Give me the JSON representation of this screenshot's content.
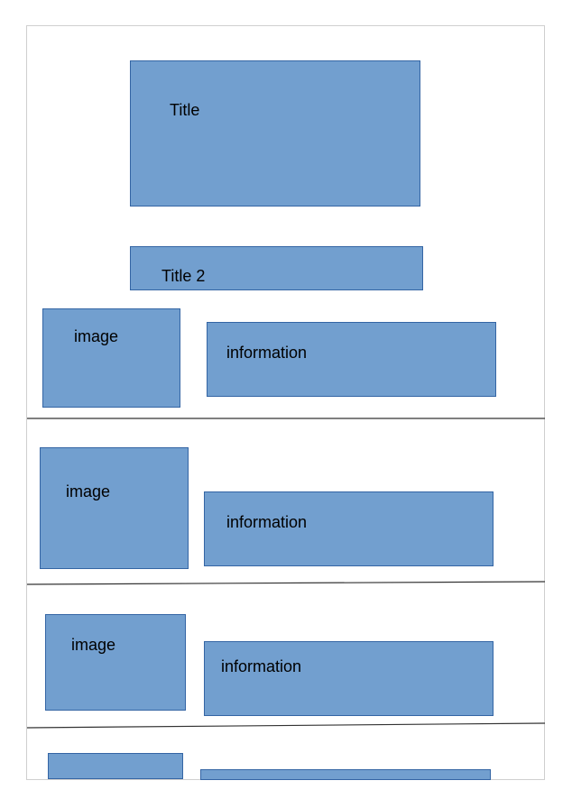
{
  "header": {
    "title": "Title",
    "title2": "Title 2"
  },
  "rows": [
    {
      "image_label": "image",
      "info_label": "information"
    },
    {
      "image_label": "image",
      "info_label": "information"
    },
    {
      "image_label": "image",
      "info_label": "information"
    },
    {
      "image_label": "",
      "info_label": ""
    }
  ],
  "colors": {
    "box_fill": "#729fcf",
    "box_border": "#3465a4",
    "divider": "#333333",
    "page_border": "#cfcfcf"
  }
}
